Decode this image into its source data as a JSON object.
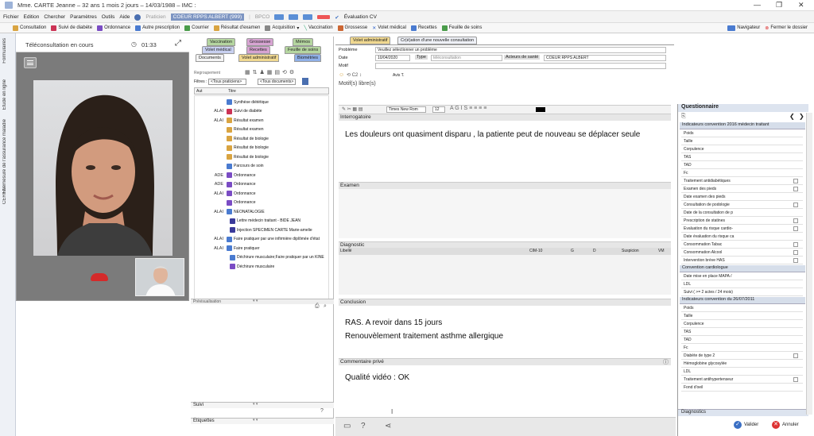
{
  "window": {
    "title": "Mme. CARTE Jeanne – 32 ans 1 mois 2 jours – 14/03/1988 – IMC :"
  },
  "menu": {
    "items": [
      "Fichier",
      "Edition",
      "Chercher",
      "Paramètres",
      "Outils",
      "Aide"
    ],
    "practitioner_label": "Praticien",
    "practitioner_value": "COEUR RPPS ALBERT (999)",
    "bpco": "BPCO",
    "eval": "Évaluation CV"
  },
  "toolbar": {
    "items": [
      "Consultation",
      "Suivi de diabète",
      "Ordonnance",
      "Autre prescription",
      "Courrier",
      "Résultat d'examen",
      "Acquisition",
      "Vaccination",
      "Grossesse",
      "Volet médical",
      "Recettes",
      "Feuille de soins"
    ],
    "right": [
      "Navigateur",
      "Fermer le dossier"
    ]
  },
  "side_tabs": [
    "Formulaires",
    "Etude en ligne",
    "Télémesure de l'assurance maladie",
    "CERFA"
  ],
  "video": {
    "status": "Téléconsultation en cours",
    "timer": "01:33"
  },
  "mid": {
    "tabs_row1": [
      "Vaccination",
      "Grossesse",
      "Mémos"
    ],
    "tabs_row2": [
      "Volet médical",
      "Recettes",
      "Feuille de soins"
    ],
    "tabs_row3": [
      "Documents",
      "Volet administratif",
      "Biométries"
    ],
    "group_label": "Regroupement",
    "filter_label": "Filtres :",
    "filter1": "<Tous praticiens>",
    "filter2": "<Tous documents>",
    "col_auteur": "Aut",
    "col_titre": "Titre",
    "rows": [
      {
        "a": "",
        "t": "Synthèse diététique"
      },
      {
        "a": "ALAI",
        "t": "Suivi de diabète"
      },
      {
        "a": "ALAI",
        "t": "Résultat examen"
      },
      {
        "a": "",
        "t": "Résultat examen"
      },
      {
        "a": "",
        "t": "Résultat de biologie"
      },
      {
        "a": "",
        "t": "Résultat de biologie"
      },
      {
        "a": "",
        "t": "Résultat de biologie"
      },
      {
        "a": "",
        "t": "Parcours de soin"
      },
      {
        "a": "ADE",
        "t": "Ordonnance"
      },
      {
        "a": "ADE",
        "t": "Ordonnance"
      },
      {
        "a": "ALAI",
        "t": "Ordonnance"
      },
      {
        "a": "",
        "t": "Ordonnance"
      },
      {
        "a": "ALAI",
        "t": "NEONATALOGIE"
      },
      {
        "a": "",
        "t": "Lettre médecin traitant - BIDE JEAN"
      },
      {
        "a": "",
        "t": "Injection SPECIMEN CARTE Marie-amelie"
      },
      {
        "a": "ALAI",
        "t": "Faire pratiquer par une infirmière diplômée d'état"
      },
      {
        "a": "ALAI",
        "t": "Faire pratiquer"
      },
      {
        "a": "",
        "t": "Déchirure musculaire;Faire pratiquer par un KINE"
      },
      {
        "a": "",
        "t": "Déchirure musculaire"
      }
    ],
    "preview_label": "Prévisualisation",
    "suivi_label": "Suivi",
    "etiquettes_label": "Etiquettes"
  },
  "main": {
    "tabs": [
      "Volet administratif",
      "Cr(é)ation d'une nouvelle consultation"
    ],
    "probleme_label": "Problème",
    "probleme_value": "Veuillez sélectionner un problème",
    "date_label": "Date",
    "date_value": "10/04/2020",
    "type_label": "Type",
    "type_value": "téléconsultation",
    "acteurs_label": "Acteurs de santé",
    "acteurs_value": "COEUR RPPS ALBERT",
    "motif_label": "Motif",
    "avis": "Avis T.",
    "motifs_libres": "Motif(s) libre(s)",
    "font_name": "Times New Rom",
    "font_size": "12",
    "interrogatoire_label": "Interrogatoire",
    "interrogatoire_text": "Les douleurs ont quasiment disparu , la patiente peut de nouveau se déplacer seule",
    "examen_label": "Examen",
    "diagnostic_label": "Diagnostic",
    "diag_cols": [
      "Libellé",
      "CIM-10",
      "G",
      "D",
      "Suspicion",
      "VM"
    ],
    "conclusion_label": "Conclusion",
    "conclusion_line1": "RAS. A revoir dans 15 jours",
    "conclusion_line2": "Renouvèlement traitement asthme allergique",
    "commentaire_label": "Commentaire privé",
    "commentaire_text": "Qualité  vidéo : OK"
  },
  "questionnaire": {
    "title": "Questionnaire",
    "group1": "Indicateurs convention 2016 médecin traitant",
    "items1": [
      "Poids",
      "Taille",
      "Corpulence",
      "TAS",
      "TAD",
      "Fc",
      "Traitement antidiabétiques",
      "Examen des pieds",
      "Date examen des pieds",
      "Consultation de podologie",
      "Date de la consultation de p",
      "Prescription de statines",
      "Evaluation du risque cardio-",
      "Date évaluation du risque ca",
      "Consommation Tabac",
      "Consommation Alcool",
      "Intervention brève HAS"
    ],
    "group2": "Convention cardiologue",
    "items2": [
      "Date mise en place MAPA /",
      "LDL",
      "Suivi ( >= 2 actes / 24 mois)"
    ],
    "group3": "Indicateurs convention du 26/07/2011",
    "items3": [
      "Poids",
      "Taille",
      "Corpulence",
      "TAS",
      "TAD",
      "Fc",
      "Diabète de type 2",
      "Hémoglobine glycosylée",
      "LDL",
      "Traitement antihypertenseur",
      "Fond d'oeil"
    ],
    "diagnostics_label": "Diagnostics"
  },
  "footer": {
    "valider": "Valider",
    "annuler": "Annuler"
  }
}
